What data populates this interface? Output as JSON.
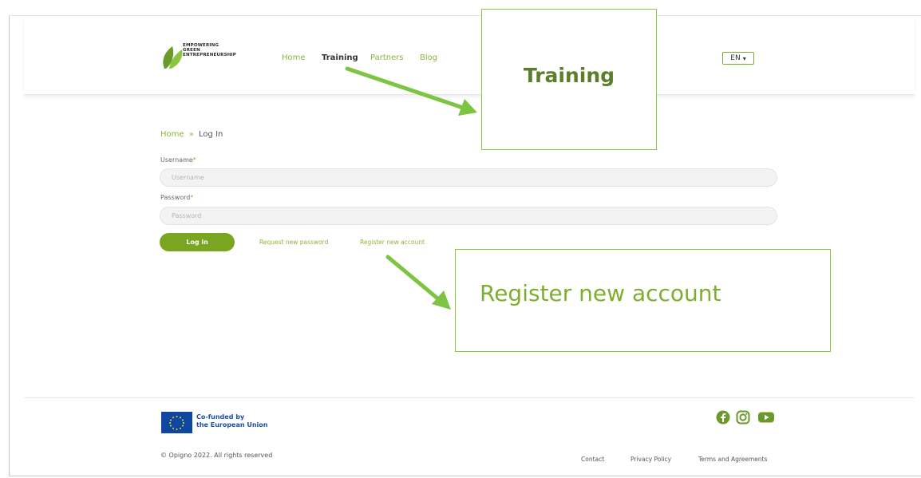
{
  "header": {
    "logo_lines": [
      "EMPOWERING",
      "GREEN",
      "ENTREPRENEURSHIP"
    ],
    "nav": [
      {
        "label": "Home"
      },
      {
        "label": "Training"
      },
      {
        "label": "Partners"
      },
      {
        "label": "Blog"
      }
    ],
    "language": "EN"
  },
  "annotations": {
    "training_callout": "Training",
    "register_callout": "Register new account"
  },
  "breadcrumb": {
    "home": "Home",
    "separator": "»",
    "current": "Log In"
  },
  "form": {
    "username_label": "Username",
    "username_placeholder": "Username",
    "password_label": "Password",
    "password_placeholder": "Password",
    "required_mark": "*",
    "login_button": "Log in",
    "request_password_link": "Request new password",
    "register_link": "Register new account"
  },
  "footer": {
    "eu_line1": "Co-funded by",
    "eu_line2": "the European Union",
    "copyright": "© Opigno 2022. All rights reserved",
    "links": [
      "Contact",
      "Privacy Policy",
      "Terms and Agreements"
    ],
    "social_icons": [
      "facebook-icon",
      "instagram-icon",
      "youtube-icon"
    ]
  },
  "colors": {
    "accent_green": "#8bb63a",
    "button_green": "#7aa521",
    "callout_border": "#8cc63f",
    "arrow_green": "#7dc443",
    "eu_blue": "#0e47a1"
  }
}
